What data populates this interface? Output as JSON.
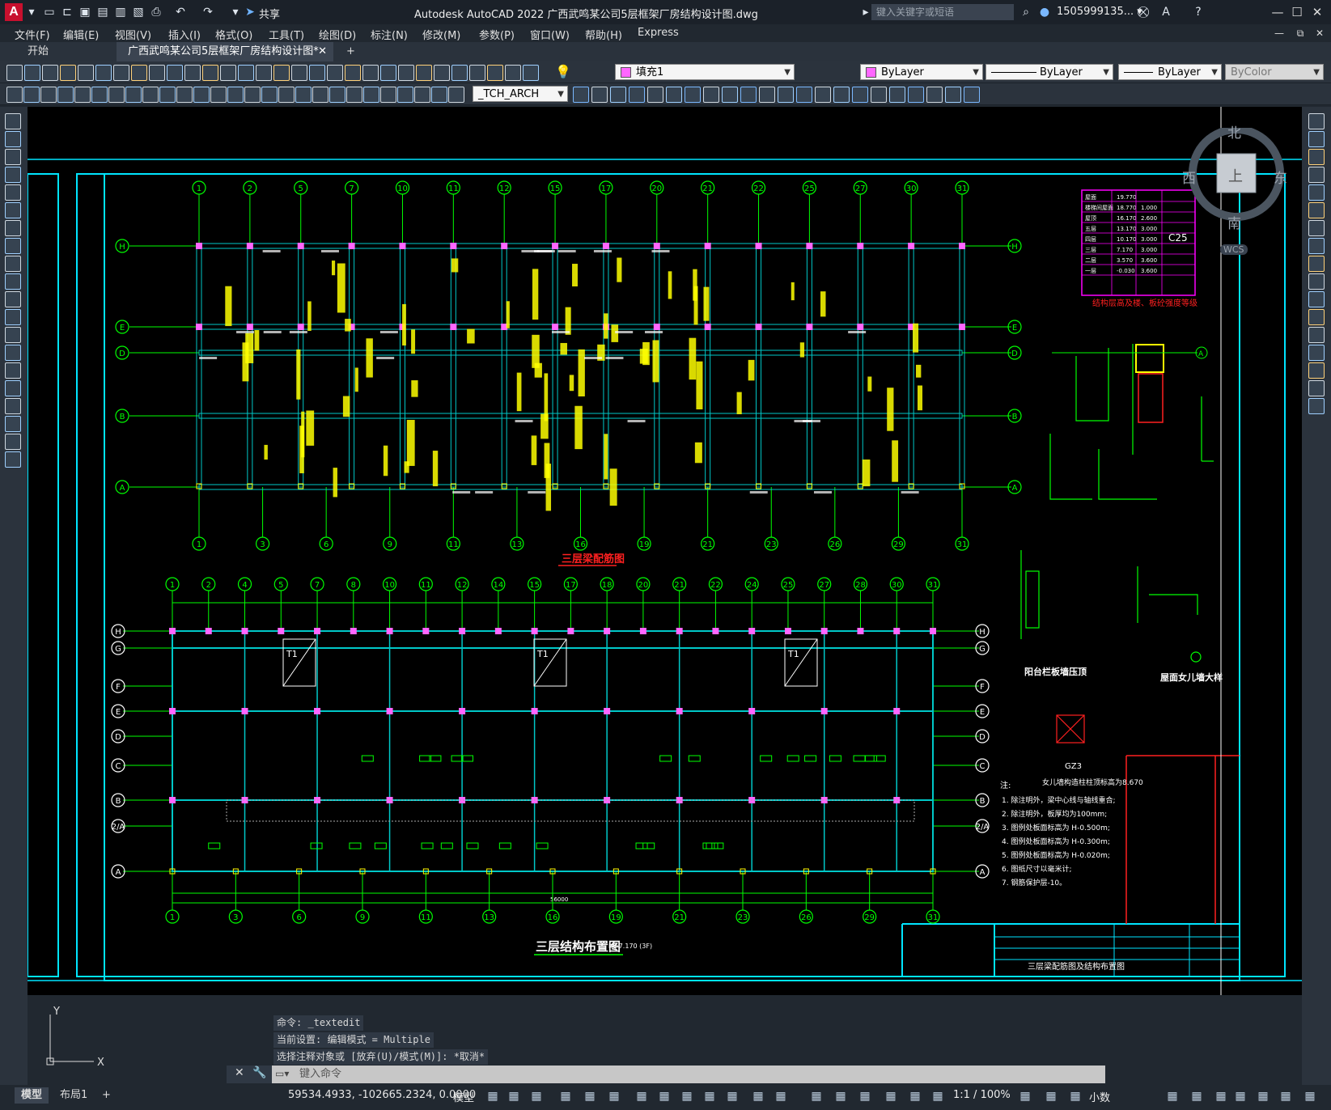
{
  "app": {
    "title": "Autodesk AutoCAD 2022    广西武鸣某公司5层框架厂房结构设计图.dwg",
    "logo": "A",
    "share_label": "共享",
    "search_placeholder": "键入关键字或短语",
    "user": "1505999135... ▾"
  },
  "menu": [
    "文件(F)",
    "编辑(E)",
    "视图(V)",
    "插入(I)",
    "格式(O)",
    "工具(T)",
    "绘图(D)",
    "标注(N)",
    "修改(M)",
    "参数(P)",
    "窗口(W)",
    "帮助(H)",
    "Express"
  ],
  "tabs": {
    "start": "开始",
    "document": "广西武鸣某公司5层框架厂房结构设计图*",
    "add": "+"
  },
  "toolbar": {
    "layer_value": "填充1",
    "color_value": "ByLayer",
    "linetype_value": "ByLayer",
    "lineweight_value": "ByLayer",
    "plotstyle_value": "ByColor",
    "textstyle_value": "_TCH_ARCH"
  },
  "viewcube": {
    "north": "北",
    "south": "南",
    "east": "东",
    "west": "西",
    "top": "上",
    "wcs": "WCS"
  },
  "drawing": {
    "upper_plan_title": "三层梁配筋图",
    "lower_plan_title": "三层结构布置图",
    "lower_plan_elev": "H=7.170 (3F)",
    "upper_axes_top": [
      "1",
      "2",
      "5",
      "7",
      "10",
      "11",
      "12",
      "15",
      "17",
      "20",
      "21",
      "22",
      "25",
      "27",
      "30",
      "31"
    ],
    "upper_axes_bottom": [
      "1",
      "3",
      "6",
      "9",
      "11",
      "13",
      "16",
      "19",
      "21",
      "23",
      "26",
      "29",
      "31"
    ],
    "upper_rows": [
      "H",
      "E",
      "D",
      "B",
      "A"
    ],
    "lower_axes_top": [
      "1",
      "2",
      "4",
      "5",
      "7",
      "8",
      "10",
      "11",
      "12",
      "14",
      "15",
      "17",
      "18",
      "20",
      "21",
      "22",
      "24",
      "25",
      "27",
      "28",
      "30",
      "31"
    ],
    "lower_axes_bottom": [
      "1",
      "3",
      "6",
      "9",
      "11",
      "13",
      "16",
      "19",
      "21",
      "23",
      "26",
      "29",
      "31"
    ],
    "lower_rows": [
      "H",
      "G",
      "F",
      "E",
      "D",
      "C",
      "B",
      "2/A",
      "A"
    ],
    "total_dim": "56000",
    "t1_label": "T1",
    "concrete_grade": "C25",
    "elev_table": [
      [
        "屋面",
        "19.770",
        ""
      ],
      [
        "楼梯间屋面",
        "18.770",
        "1.000"
      ],
      [
        "屋顶",
        "16.170",
        "2.600"
      ],
      [
        "五层",
        "13.170",
        "3.000"
      ],
      [
        "四层",
        "10.170",
        "3.000"
      ],
      [
        "三层",
        "7.170",
        "3.000"
      ],
      [
        "二层",
        "3.570",
        "3.600"
      ],
      [
        "一层",
        "-0.030",
        "3.600"
      ]
    ],
    "elev_table_caption": "结构层高及楼、板砼强度等级",
    "detail1_title": "阳台栏板墙压顶",
    "detail2_title": "屋面女儿墙大样",
    "gz3_label": "GZ3",
    "gz3_note": "女儿墙构造柱柱顶标高为8.670",
    "notes_title": "注:",
    "notes": [
      "1. 除注明外，梁中心线与轴线重合;",
      "2. 除注明外，板厚均为100mm;",
      "3.          图例处板面标高为 H-0.500m;",
      "4.          图例处板面标高为 H-0.300m;",
      "5.          图例处板面标高为 H-0.020m;",
      "6. 图纸尺寸以毫米计;",
      "7. 钢筋保护层-10。"
    ],
    "titleblock_name": "三层梁配筋图及结构布置图"
  },
  "command": {
    "history": [
      "命令: _textedit",
      "当前设置: 编辑模式 = Multiple",
      "选择注释对象或 [放弃(U)/模式(M)]: *取消*"
    ],
    "placeholder": "键入命令"
  },
  "status": {
    "tab_model": "模型",
    "tab_layout": "布局1",
    "coords": "59534.4933, -102665.2324, 0.0000",
    "model_label": "模型",
    "scale": "1:1 / 100%",
    "units": "小数"
  },
  "colors": {
    "accent_cyan": "#00e5ff",
    "accent_green": "#00ff00",
    "accent_magenta": "#ff00ff",
    "accent_yellow": "#ffff00",
    "accent_red": "#ff0000"
  }
}
